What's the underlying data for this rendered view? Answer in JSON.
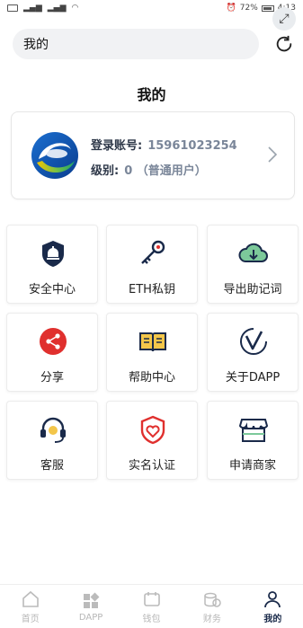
{
  "status_bar": {
    "battery": "72%",
    "time": "4:13"
  },
  "search": {
    "value": "我的"
  },
  "page_title": "我的",
  "account": {
    "login_label": "登录账号:",
    "login_value": "15961023254",
    "level_label": "级别:",
    "level_value": "0 （普通用户）"
  },
  "menu": [
    {
      "label": "安全中心",
      "icon": "security-bell-icon"
    },
    {
      "label": "ETH私钥",
      "icon": "key-icon"
    },
    {
      "label": "导出助记词",
      "icon": "cloud-download-icon"
    },
    {
      "label": "分享",
      "icon": "share-icon"
    },
    {
      "label": "帮助中心",
      "icon": "book-icon"
    },
    {
      "label": "关于DAPP",
      "icon": "about-v-icon"
    },
    {
      "label": "客服",
      "icon": "headset-icon"
    },
    {
      "label": "实名认证",
      "icon": "heart-shield-icon"
    },
    {
      "label": "申请商家",
      "icon": "shop-icon"
    }
  ],
  "nav": [
    {
      "label": "首页",
      "icon": "home-icon"
    },
    {
      "label": "DAPP",
      "icon": "apps-icon"
    },
    {
      "label": "钱包",
      "icon": "wallet-icon"
    },
    {
      "label": "财务",
      "icon": "coins-icon"
    },
    {
      "label": "我的",
      "icon": "user-icon",
      "active": true
    }
  ],
  "colors": {
    "navy": "#1a2a4a",
    "accent_red": "#e0302e",
    "muted": "#7a8699"
  }
}
